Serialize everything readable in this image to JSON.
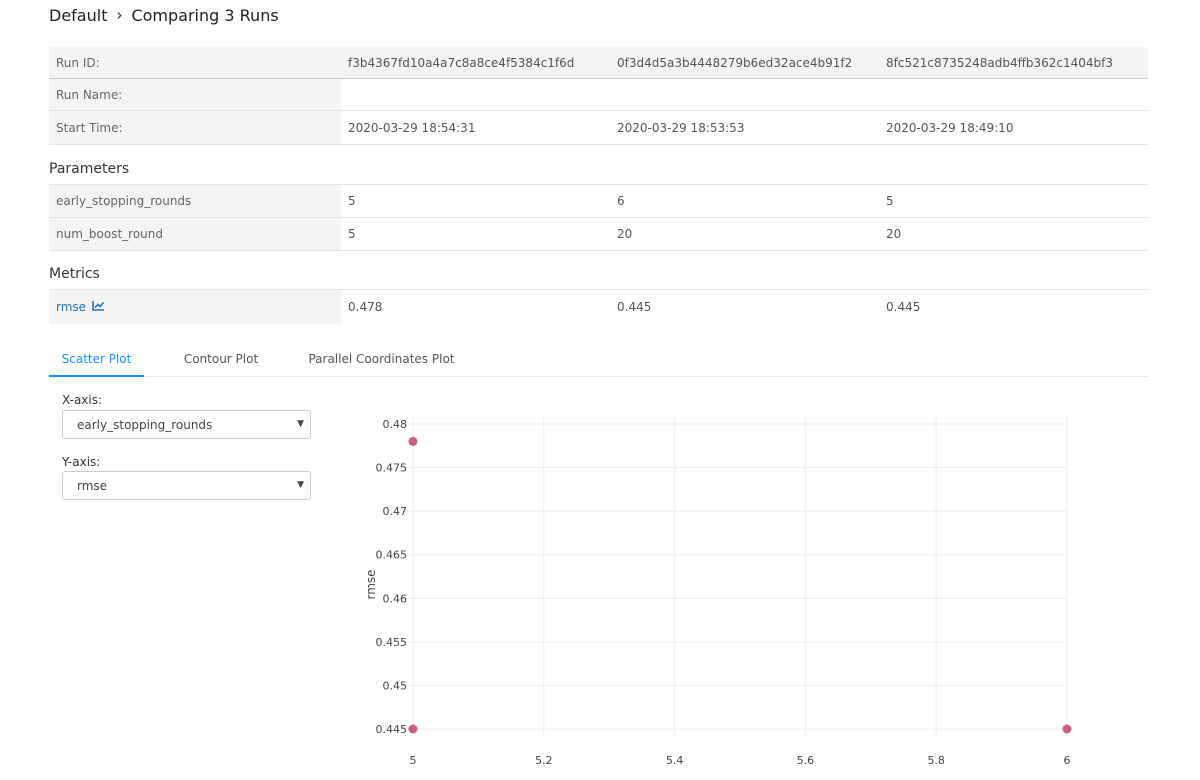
{
  "breadcrumb": {
    "root": "Default",
    "current": "Comparing 3 Runs"
  },
  "runs_table": {
    "run_id_label": "Run ID:",
    "run_name_label": "Run Name:",
    "start_time_label": "Start Time:",
    "run_ids": [
      "f3b4367fd10a4a7c8a8ce4f5384c1f6d",
      "0f3d4d5a3b4448279b6ed32ace4b91f2",
      "8fc521c8735248adb4ffb362c1404bf3"
    ],
    "run_names": [
      "",
      "",
      ""
    ],
    "start_times": [
      "2020-03-29 18:54:31",
      "2020-03-29 18:53:53",
      "2020-03-29 18:49:10"
    ]
  },
  "parameters": {
    "title": "Parameters",
    "rows": [
      {
        "name": "early_stopping_rounds",
        "values": [
          "5",
          "6",
          "5"
        ]
      },
      {
        "name": "num_boost_round",
        "values": [
          "5",
          "20",
          "20"
        ]
      }
    ]
  },
  "metrics": {
    "title": "Metrics",
    "rows": [
      {
        "name": "rmse",
        "icon": "line-chart-icon",
        "values": [
          "0.478",
          "0.445",
          "0.445"
        ]
      }
    ]
  },
  "tabs": [
    {
      "label": "Scatter Plot",
      "active": true
    },
    {
      "label": "Contour Plot",
      "active": false
    },
    {
      "label": "Parallel Coordinates Plot",
      "active": false
    }
  ],
  "controls": {
    "x_label": "X-axis:",
    "x_value": "early_stopping_rounds",
    "y_label": "Y-axis:",
    "y_value": "rmse"
  },
  "colors": {
    "link": "#2272b4",
    "accent": "#1890ff",
    "marker": "#c95f86"
  },
  "chart_data": {
    "type": "scatter",
    "title": "",
    "xlabel": "",
    "ylabel": "rmse",
    "xlim": [
      5,
      6
    ],
    "ylim": [
      0.445,
      0.48
    ],
    "x_ticks": [
      "5",
      "5.2",
      "5.4",
      "5.6",
      "5.8",
      "6"
    ],
    "y_ticks": [
      "0.48",
      "0.475",
      "0.47",
      "0.465",
      "0.46",
      "0.455",
      "0.45",
      "0.445"
    ],
    "grid": true,
    "series": [
      {
        "x": [
          5,
          6,
          5
        ],
        "y": [
          0.478,
          0.445,
          0.445
        ]
      }
    ]
  }
}
